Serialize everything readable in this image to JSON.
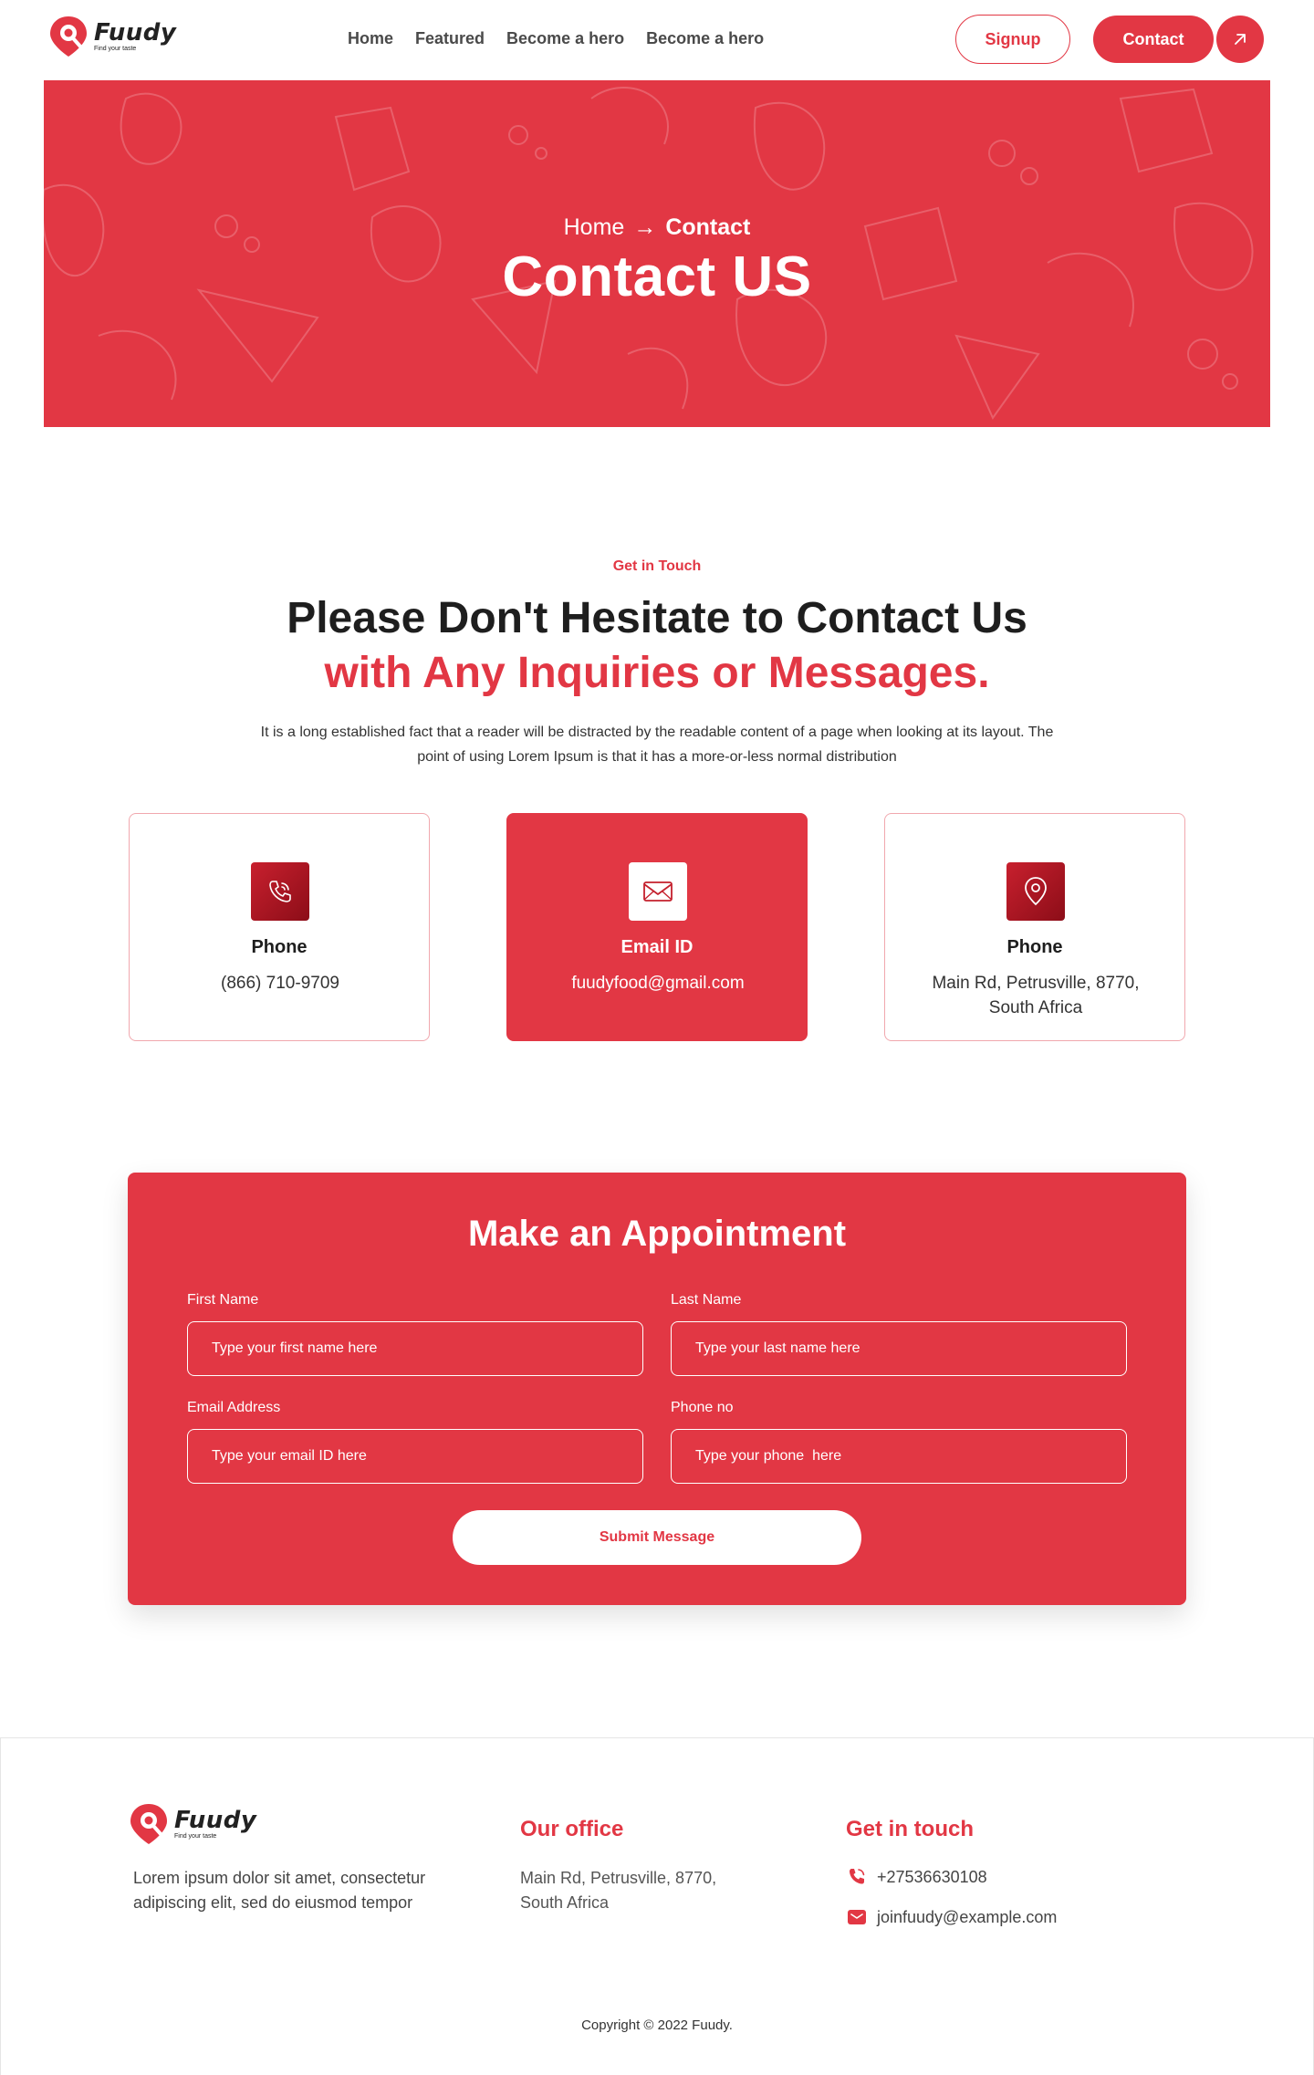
{
  "brand": {
    "name": "Fuudy",
    "tagline": "Find your taste"
  },
  "nav": {
    "links": [
      "Home",
      "Featured",
      "Become a hero",
      "Become a hero"
    ],
    "signup": "Signup",
    "contact": "Contact",
    "arrow_icon": "arrow-up-right-icon"
  },
  "hero": {
    "breadcrumb": {
      "home": "Home",
      "separator": "→",
      "current": "Contact"
    },
    "title": "Contact US"
  },
  "intro_section": {
    "eyebrow": "Get in Touch",
    "headline_line1": "Please Don't Hesitate to Contact Us",
    "headline_line2": "with Any Inquiries or Messages.",
    "body": "It is a long established fact that a reader will be distracted by the readable content of a page when looking at its layout. The point of using Lorem Ipsum is that it has a more-or-less normal distribution"
  },
  "cards": [
    {
      "icon": "phone-icon",
      "title": "Phone",
      "text": "(866) 710-9709",
      "active": false
    },
    {
      "icon": "mail-icon",
      "title": "Email ID",
      "text": "fuudyfood@gmail.com",
      "active": true
    },
    {
      "icon": "location-pin-icon",
      "title": "Phone",
      "text": "Main Rd, Petrusville, 8770, South Africa",
      "active": false
    }
  ],
  "form": {
    "title": "Make an Appointment",
    "first_name": {
      "label": "First Name",
      "placeholder": "Type your first name here"
    },
    "last_name": {
      "label": "Last Name",
      "placeholder": "Type your last name here"
    },
    "email": {
      "label": "Email Address",
      "placeholder": "Type your email ID here"
    },
    "phone": {
      "label": "Phone no",
      "placeholder": "Type your phone  here"
    },
    "submit": "Submit Message"
  },
  "footer": {
    "about": "Lorem ipsum dolor sit amet, consectetur adipiscing elit, sed do eiusmod tempor",
    "office_heading": "Our office",
    "office_address": "Main Rd, Petrusville, 8770, South Africa",
    "touch_heading": "Get in touch",
    "phone": "+27536630108",
    "email": "joinfuudy@example.com",
    "copyright": "Copyright © 2022 Fuudy."
  },
  "colors": {
    "accent": "#e23744",
    "dark": "#1e1e1e",
    "icon_dark": "#8c0d18"
  }
}
